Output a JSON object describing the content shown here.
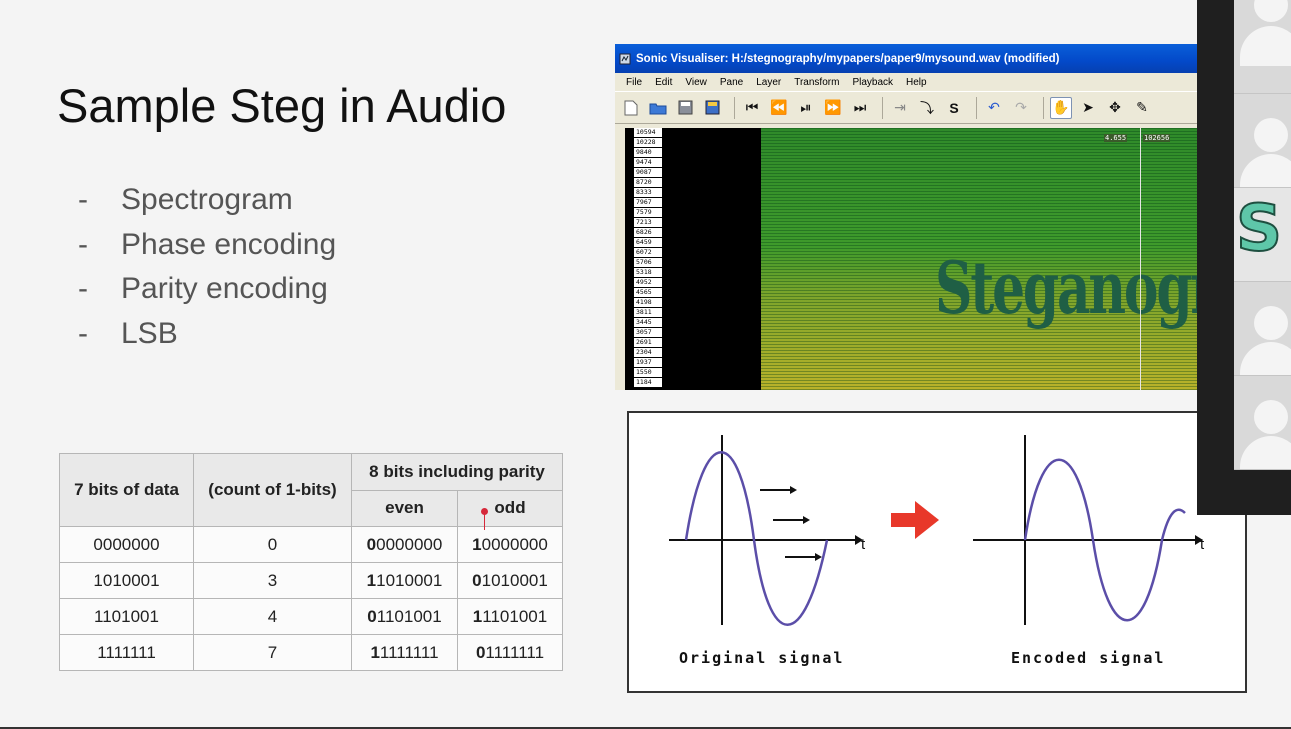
{
  "slide": {
    "title": "Sample Steg in Audio",
    "bullets": [
      "Spectrogram",
      "Phase encoding",
      "Parity encoding",
      "LSB"
    ],
    "bullet_marker": "-"
  },
  "parity_table": {
    "headers": {
      "col1": "7 bits of data",
      "col2": "(count of 1-bits)",
      "group": "8 bits including parity",
      "even": "even",
      "odd": "odd"
    },
    "rows": [
      {
        "data": "0000000",
        "count": "0",
        "even_bit": "0",
        "even_rest": "0000000",
        "odd_bit": "1",
        "odd_rest": "0000000"
      },
      {
        "data": "1010001",
        "count": "3",
        "even_bit": "1",
        "even_rest": "1010001",
        "odd_bit": "0",
        "odd_rest": "1010001"
      },
      {
        "data": "1101001",
        "count": "4",
        "even_bit": "0",
        "even_rest": "1101001",
        "odd_bit": "1",
        "odd_rest": "1101001"
      },
      {
        "data": "1111111",
        "count": "7",
        "even_bit": "1",
        "even_rest": "1111111",
        "odd_bit": "0",
        "odd_rest": "1111111"
      }
    ]
  },
  "sonic_visualiser": {
    "title": "Sonic Visualiser: H:/stegnography/mypapers/paper9/mysound.wav (modified)",
    "menu": [
      "File",
      "Edit",
      "View",
      "Pane",
      "Layer",
      "Transform",
      "Playback",
      "Help"
    ],
    "scale_labels": [
      "10594",
      "10228",
      "9840",
      "9474",
      "9087",
      "8720",
      "8333",
      "7967",
      "7579",
      "7213",
      "6826",
      "6459",
      "6072",
      "5706",
      "5318",
      "4952",
      "4565",
      "4198",
      "3811",
      "3445",
      "3057",
      "2691",
      "2304",
      "1937",
      "1550",
      "1184"
    ],
    "readout_left": "4.655",
    "readout_right": "102656",
    "spectrogram_text": "Steganograpl"
  },
  "phase_diagram": {
    "axis_label_left": "t",
    "axis_label_right": "t",
    "label_original": "Original signal",
    "label_encoded": "Encoded signal"
  },
  "colors": {
    "accent_red": "#e8382a",
    "wave_blue": "#5b4ea8",
    "spectro_green": "#2f8a2a",
    "xp_blue": "#0a5fd9"
  }
}
